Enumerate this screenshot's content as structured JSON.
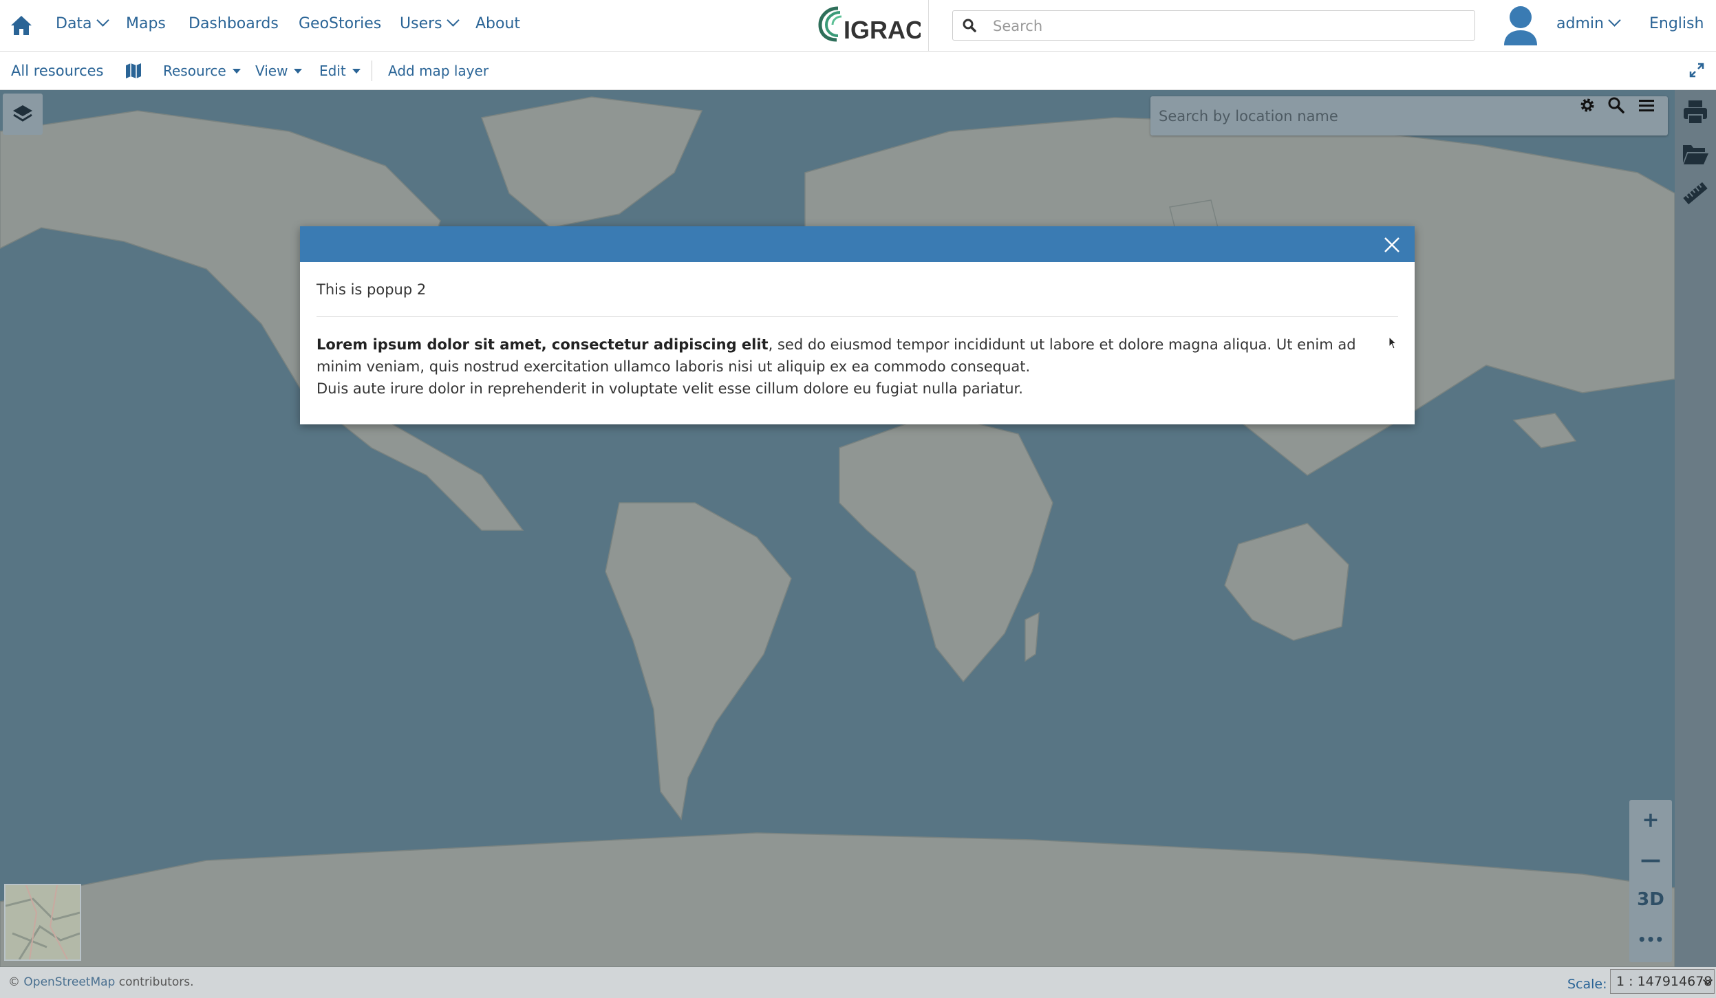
{
  "topnav": {
    "items": [
      {
        "label": "Data",
        "dropdown": true
      },
      {
        "label": "Maps",
        "dropdown": false
      },
      {
        "label": "Dashboards",
        "dropdown": false
      },
      {
        "label": "GeoStories",
        "dropdown": false
      },
      {
        "label": "Users",
        "dropdown": true
      },
      {
        "label": "About",
        "dropdown": false
      }
    ],
    "logo_text": "IGRAC",
    "search_placeholder": "Search",
    "user_label": "admin",
    "language_label": "English"
  },
  "subnav": {
    "all_resources": "All resources",
    "resource": "Resource",
    "view": "View",
    "edit": "Edit",
    "add_map_layer": "Add map layer"
  },
  "map": {
    "location_search_placeholder": "Search by location name",
    "zoom_in": "+",
    "zoom_out": "—",
    "three_d": "3D",
    "more": "•••"
  },
  "popup": {
    "title": "This is popup 2",
    "body_bold": "Lorem ipsum dolor sit amet, consectetur adipiscing elit",
    "body_rest": ", sed do eiusmod tempor incididunt ut labore et dolore magna aliqua. Ut enim ad minim veniam, quis nostrud exercitation ullamco laboris nisi ut aliquip ex ea commodo consequat.",
    "body_line2": "Duis aute irure dolor in reprehenderit in voluptate velit esse cillum dolore eu fugiat nulla pariatur."
  },
  "footer": {
    "attribution_symbol": "©",
    "attribution_link": "OpenStreetMap",
    "attribution_rest": "contributors.",
    "scale_label": "Scale:",
    "scale_value": "1 : 147914678"
  },
  "colors": {
    "accent": "#3a7bb3",
    "link": "#2a6496",
    "ocean": "#6b8fa0",
    "land": "#b9bdb4"
  },
  "icons": [
    "home-icon",
    "search-icon",
    "user-avatar-icon",
    "map-icon",
    "layers-icon",
    "gear-icon",
    "menu-icon",
    "print-icon",
    "folder-open-icon",
    "ruler-icon",
    "close-icon",
    "expand-icon"
  ]
}
